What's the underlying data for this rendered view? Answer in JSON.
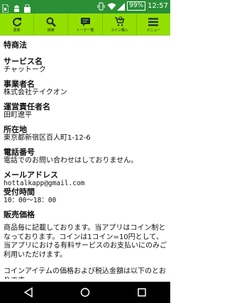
{
  "status_bar": {
    "time": "12:57",
    "battery": "99%",
    "icons": [
      "sim-card-icon",
      "android-icon",
      "bag-icon",
      "vibrate-icon",
      "wifi-icon",
      "signal-icon",
      "battery-icon"
    ]
  },
  "toolbar": {
    "buttons": [
      {
        "label": "更新",
        "icon": "refresh-icon"
      },
      {
        "label": "検索",
        "icon": "search-icon"
      },
      {
        "label": "トーク一覧",
        "icon": "chat-list-icon"
      },
      {
        "label": "コイン購入",
        "icon": "coin-purchase-icon"
      },
      {
        "label": "メニュー",
        "icon": "menu-icon"
      }
    ]
  },
  "content": {
    "page_title": "特商法",
    "sections": [
      {
        "heading": "サービス名",
        "value": "チャットーク"
      },
      {
        "heading": "事業者名",
        "value": "株式会社テイクオン"
      },
      {
        "heading": "運営責任者名",
        "value": "田町遼平"
      },
      {
        "heading": "所在地",
        "value": "東京都新宿区百人町1-12-6"
      },
      {
        "heading": "電話番号",
        "value": "電話でのお問い合わせはしておりません。"
      },
      {
        "heading": "メールアドレス",
        "value": "hottalkapp@gmail.com"
      },
      {
        "heading": "受付時間",
        "value": "10：00〜18：00"
      }
    ],
    "price_heading": "販売価格",
    "price_para1": "商品毎に記載しております。当アプリはコイン制となっております。コインは1コイン=10円として、当アプリにおける有料サービスのお支払いにのみご利用いただけます。",
    "price_para2": "コインアイテムの価格および税込金額は以下のとおりです。"
  },
  "nav_bar": {
    "icons": [
      "back-icon",
      "home-icon",
      "recent-apps-icon"
    ]
  },
  "colors": {
    "status_bar": "#2b8f37",
    "toolbar": "#93e000",
    "nav_bar": "#000000"
  }
}
